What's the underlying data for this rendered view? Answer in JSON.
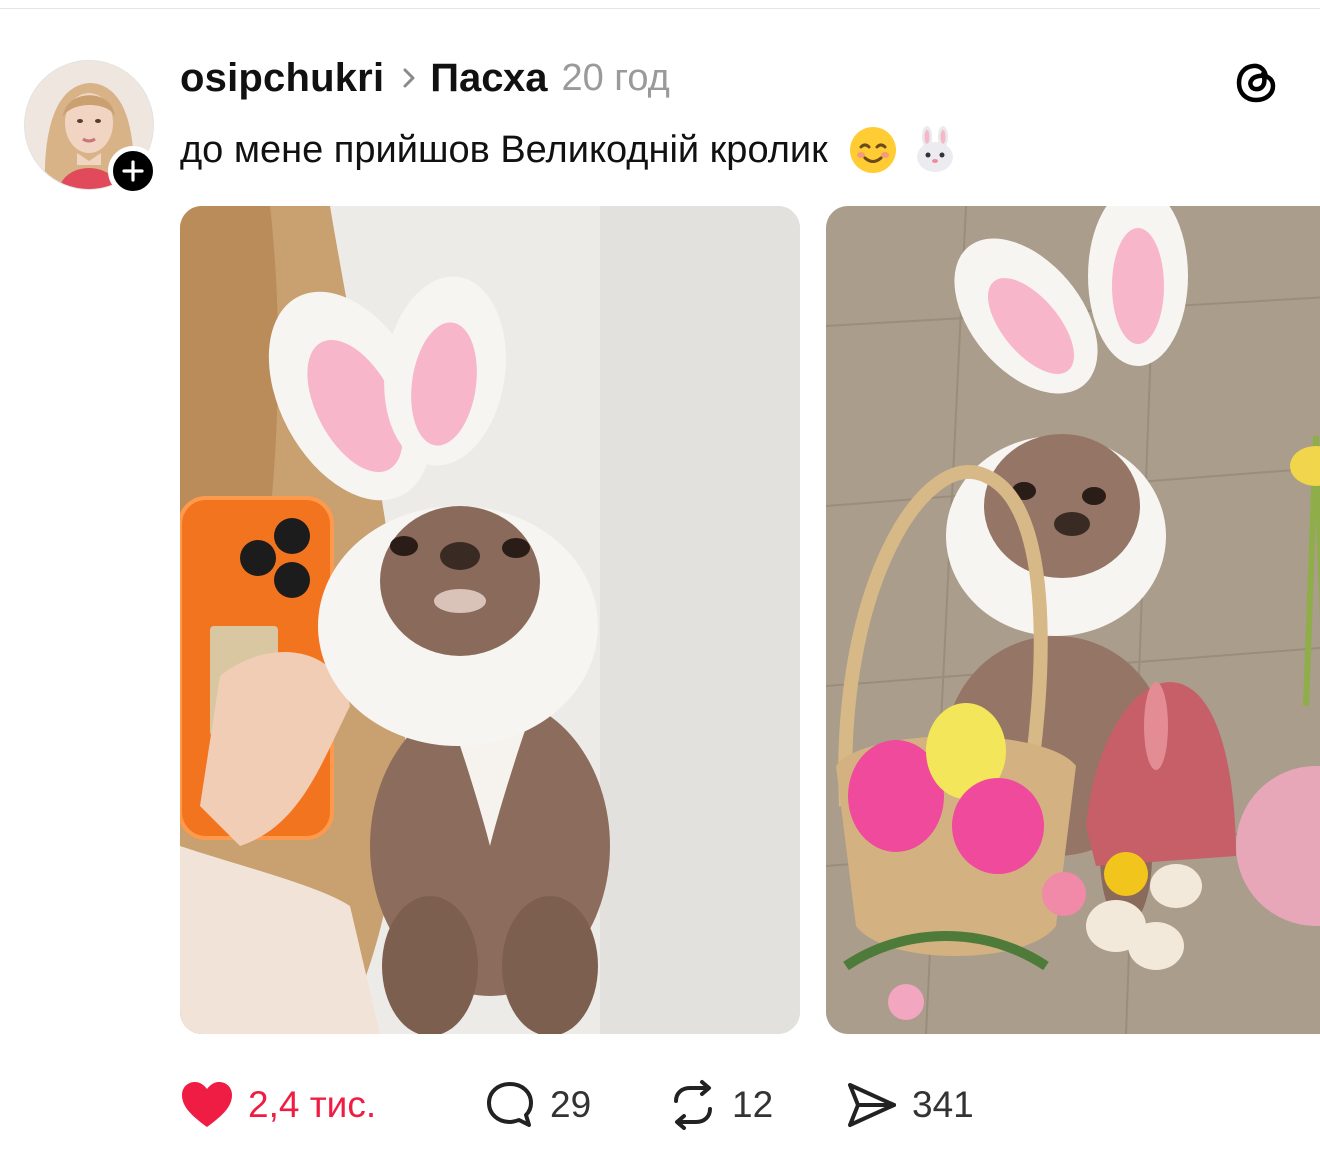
{
  "post": {
    "username": "osipchukri",
    "topic": "Пасха",
    "timestamp": "20 год",
    "caption": "до мене прийшов Великодній кролик",
    "caption_emojis": [
      "smiling-face-emoji",
      "rabbit-face-emoji"
    ]
  },
  "actions": {
    "likes": "2,4 тис.",
    "comments": "29",
    "reposts": "12",
    "shares": "341"
  },
  "media": {
    "count": 2,
    "items": [
      "chihuahua-in-bunny-ears-held-photo",
      "chihuahua-with-easter-basket-photo"
    ]
  },
  "icons": {
    "app_logo": "threads-logo-icon",
    "follow": "plus-icon",
    "breadcrumb": "chevron-right-icon",
    "like": "heart-filled-icon",
    "comment": "comment-bubble-icon",
    "repost": "repost-icon",
    "share": "share-send-icon"
  },
  "colors": {
    "like_active": "#ef1c43",
    "muted_text": "#9a9a9a",
    "text": "#111111",
    "background": "#ffffff"
  }
}
